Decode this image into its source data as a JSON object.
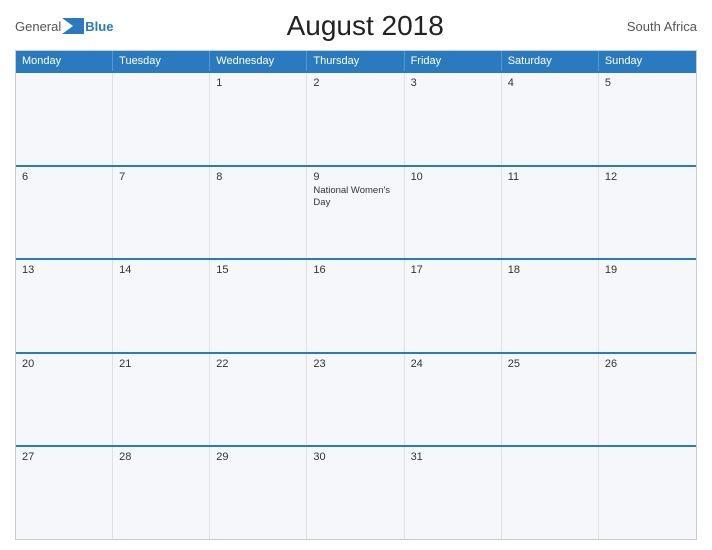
{
  "header": {
    "logo_general": "General",
    "logo_blue": "Blue",
    "title": "August 2018",
    "country": "South Africa"
  },
  "day_headers": [
    "Monday",
    "Tuesday",
    "Wednesday",
    "Thursday",
    "Friday",
    "Saturday",
    "Sunday"
  ],
  "weeks": [
    {
      "days": [
        {
          "number": "",
          "event": ""
        },
        {
          "number": "",
          "event": ""
        },
        {
          "number": "1",
          "event": ""
        },
        {
          "number": "2",
          "event": ""
        },
        {
          "number": "3",
          "event": ""
        },
        {
          "number": "4",
          "event": ""
        },
        {
          "number": "5",
          "event": ""
        }
      ]
    },
    {
      "days": [
        {
          "number": "6",
          "event": ""
        },
        {
          "number": "7",
          "event": ""
        },
        {
          "number": "8",
          "event": ""
        },
        {
          "number": "9",
          "event": "National Women's Day"
        },
        {
          "number": "10",
          "event": ""
        },
        {
          "number": "11",
          "event": ""
        },
        {
          "number": "12",
          "event": ""
        }
      ]
    },
    {
      "days": [
        {
          "number": "13",
          "event": ""
        },
        {
          "number": "14",
          "event": ""
        },
        {
          "number": "15",
          "event": ""
        },
        {
          "number": "16",
          "event": ""
        },
        {
          "number": "17",
          "event": ""
        },
        {
          "number": "18",
          "event": ""
        },
        {
          "number": "19",
          "event": ""
        }
      ]
    },
    {
      "days": [
        {
          "number": "20",
          "event": ""
        },
        {
          "number": "21",
          "event": ""
        },
        {
          "number": "22",
          "event": ""
        },
        {
          "number": "23",
          "event": ""
        },
        {
          "number": "24",
          "event": ""
        },
        {
          "number": "25",
          "event": ""
        },
        {
          "number": "26",
          "event": ""
        }
      ]
    },
    {
      "days": [
        {
          "number": "27",
          "event": ""
        },
        {
          "number": "28",
          "event": ""
        },
        {
          "number": "29",
          "event": ""
        },
        {
          "number": "30",
          "event": ""
        },
        {
          "number": "31",
          "event": ""
        },
        {
          "number": "",
          "event": ""
        },
        {
          "number": "",
          "event": ""
        }
      ]
    }
  ]
}
